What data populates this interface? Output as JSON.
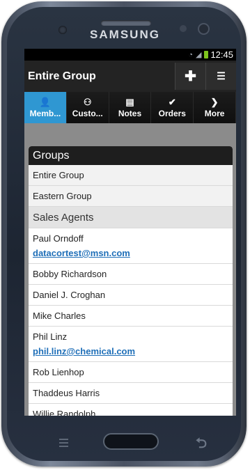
{
  "device": {
    "brand": "SAMSUNG"
  },
  "status_bar": {
    "time": "12:45"
  },
  "header": {
    "title": "Entire Group",
    "add_icon": "plus-icon",
    "list_icon": "list-icon"
  },
  "tabs": [
    {
      "label": "Memb...",
      "icon": "person-icon",
      "active": true
    },
    {
      "label": "Custo...",
      "icon": "people-icon",
      "active": false
    },
    {
      "label": "Notes",
      "icon": "notes-icon",
      "active": false
    },
    {
      "label": "Orders",
      "icon": "check-icon",
      "active": false
    },
    {
      "label": "More",
      "icon": "chevron-right-icon",
      "active": false
    }
  ],
  "panel": {
    "title": "Groups",
    "groups": [
      "Entire Group",
      "Eastern Group"
    ],
    "section": "Sales Agents",
    "members": [
      {
        "name": "Paul Orndoff",
        "email": "datacortest@msn.com"
      },
      {
        "name": "Bobby Richardson"
      },
      {
        "name": "Daniel J. Croghan"
      },
      {
        "name": "Mike Charles"
      },
      {
        "name": "Phil Linz",
        "email": "phil.linz@chemical.com"
      },
      {
        "name": "Rob Lienhop"
      },
      {
        "name": "Thaddeus Harris"
      },
      {
        "name": "Willie Randolph"
      }
    ]
  },
  "colors": {
    "active_tab": "#2f97d2",
    "link": "#1f6fb8",
    "battery": "#7ec41d"
  }
}
